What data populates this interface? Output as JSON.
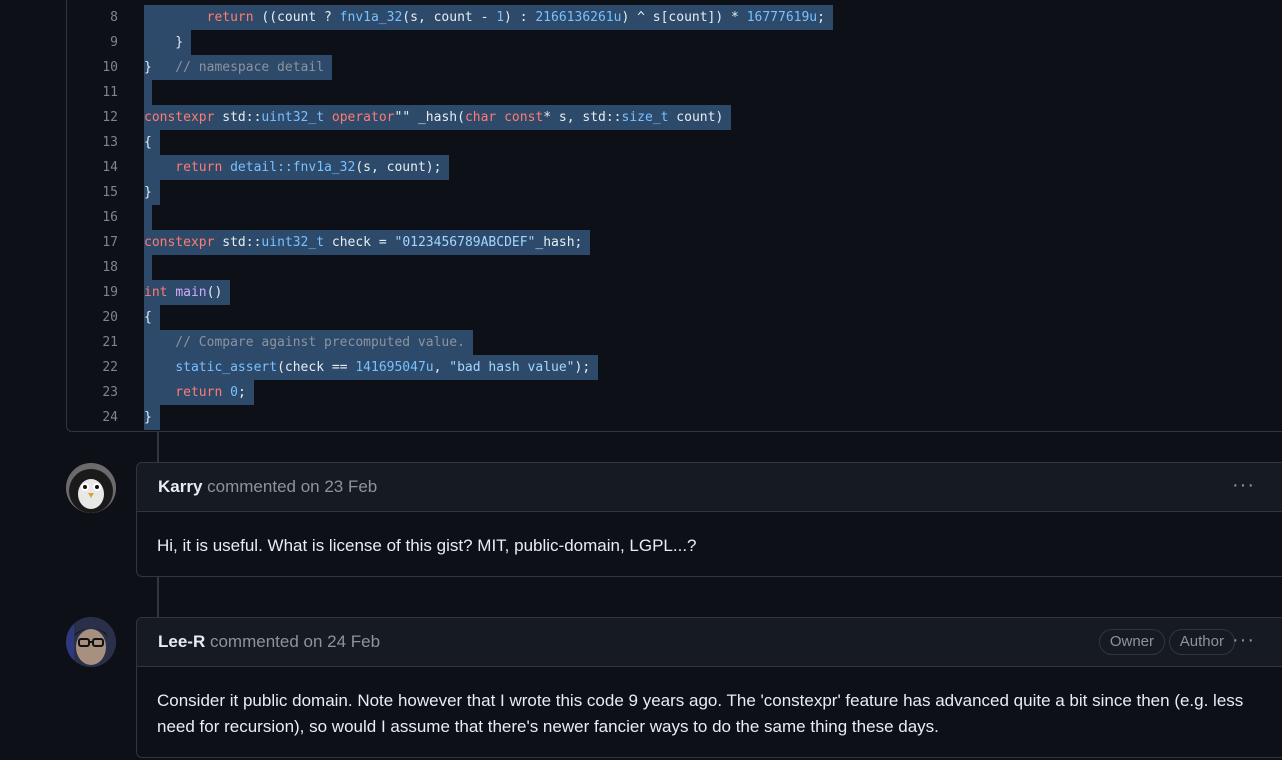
{
  "code": {
    "lines": [
      {
        "num": "8"
      },
      {
        "num": "9"
      },
      {
        "num": "10"
      },
      {
        "num": "11"
      },
      {
        "num": "12"
      },
      {
        "num": "13"
      },
      {
        "num": "14"
      },
      {
        "num": "15"
      },
      {
        "num": "16"
      },
      {
        "num": "17"
      },
      {
        "num": "18"
      },
      {
        "num": "19"
      },
      {
        "num": "20"
      },
      {
        "num": "21"
      },
      {
        "num": "22"
      },
      {
        "num": "23"
      },
      {
        "num": "24"
      }
    ],
    "tokens": {
      "l8": [
        "        return",
        " ((count ? ",
        "fnv1a_32",
        "(s, count - ",
        "1",
        ") : ",
        "2166136261u",
        ") ^ s[count]) * ",
        "16777619u",
        ";"
      ],
      "l9": [
        "    }"
      ],
      "l10": [
        "}",
        "   // namespace detail"
      ],
      "l12": [
        "constexpr",
        " std::",
        "uint32_t",
        " ",
        "operator",
        "\"\" _hash(",
        "char",
        " ",
        "const",
        "* s, std::",
        "size_t",
        " count)"
      ],
      "l13": [
        "{"
      ],
      "l14": [
        "    return",
        " ",
        "detail::fnv1a_32",
        "(s, count);"
      ],
      "l15": [
        "}"
      ],
      "l17": [
        "constexpr",
        " std::",
        "uint32_t",
        " check = ",
        "\"0123456789ABCDEF\"",
        "_hash;"
      ],
      "l19": [
        "int",
        " ",
        "main",
        "()"
      ],
      "l20": [
        "{"
      ],
      "l21": [
        "    // Compare against precomputed value."
      ],
      "l22": [
        "    ",
        "static_assert",
        "(check == ",
        "141695047u",
        ", ",
        "\"bad hash value\"",
        ");"
      ],
      "l23": [
        "    return",
        " ",
        "0",
        ";"
      ],
      "l24": [
        "}"
      ]
    }
  },
  "comments": [
    {
      "author": "Karry",
      "meta": "commented on 23 Feb",
      "body": "Hi, it is useful. What is license of this gist? MIT, public-domain, LGPL...?",
      "menu": "···"
    },
    {
      "author": "Lee-R",
      "meta": "commented on 24 Feb",
      "badges": [
        "Owner",
        "Author"
      ],
      "body": "Consider it public domain. Note however that I wrote this code 9 years ago. The 'constexpr' feature has advanced quite a bit since then (e.g. less need for recursion), so would I assume that there's newer fancier ways to do the same thing these days.",
      "menu": "···"
    }
  ],
  "colors": {
    "background": "#0d1117",
    "selection": "#2d4a6b",
    "keyword": "#ff7b72",
    "type": "#79c0ff",
    "comment": "#8b949e",
    "border": "#30363d"
  }
}
